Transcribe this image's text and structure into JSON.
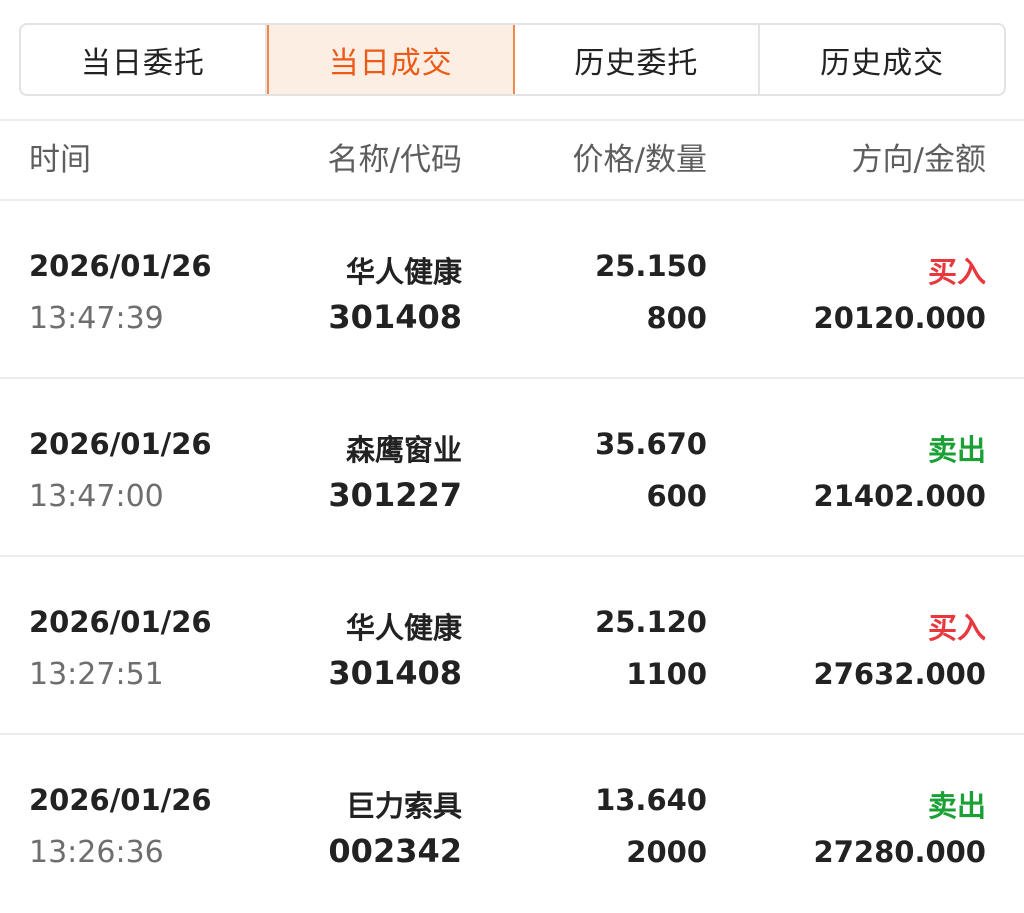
{
  "tabs": [
    {
      "label": "当日委托",
      "active": false
    },
    {
      "label": "当日成交",
      "active": true
    },
    {
      "label": "历史委托",
      "active": false
    },
    {
      "label": "历史成交",
      "active": false
    }
  ],
  "header": {
    "time": "时间",
    "name_code": "名称/代码",
    "price_qty": "价格/数量",
    "direction_amount": "方向/金额"
  },
  "rows": [
    {
      "date": "2026/01/26",
      "time": "13:47:39",
      "name": "华人健康",
      "code": "301408",
      "price": "25.150",
      "qty": "800",
      "direction": "买入",
      "side": "buy",
      "amount": "20120.000"
    },
    {
      "date": "2026/01/26",
      "time": "13:47:00",
      "name": "森鹰窗业",
      "code": "301227",
      "price": "35.670",
      "qty": "600",
      "direction": "卖出",
      "side": "sell",
      "amount": "21402.000"
    },
    {
      "date": "2026/01/26",
      "time": "13:27:51",
      "name": "华人健康",
      "code": "301408",
      "price": "25.120",
      "qty": "1100",
      "direction": "买入",
      "side": "buy",
      "amount": "27632.000"
    },
    {
      "date": "2026/01/26",
      "time": "13:26:36",
      "name": "巨力索具",
      "code": "002342",
      "price": "13.640",
      "qty": "2000",
      "direction": "卖出",
      "side": "sell",
      "amount": "27280.000"
    }
  ],
  "colors": {
    "accent": "#ec5a18",
    "active_tab_bg": "#fdeee3",
    "buy": "#e8383d",
    "sell": "#1aa034"
  }
}
